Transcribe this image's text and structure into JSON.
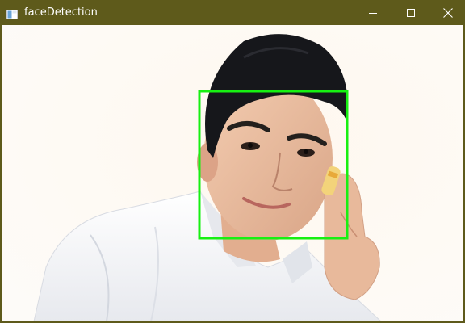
{
  "window": {
    "title": "faceDetection",
    "icons": {
      "app": "window-app-icon",
      "minimize": "minimize-icon",
      "maximize": "maximize-icon",
      "close": "close-icon"
    }
  },
  "detection": {
    "box_color": "#17f012",
    "faces_shown": 1
  },
  "colors": {
    "titlebar": "#5e5a1b",
    "background": "#fdfaf6",
    "hair": "#15161a",
    "skin": "#efc1a3",
    "shirt": "#f4f5f7"
  }
}
